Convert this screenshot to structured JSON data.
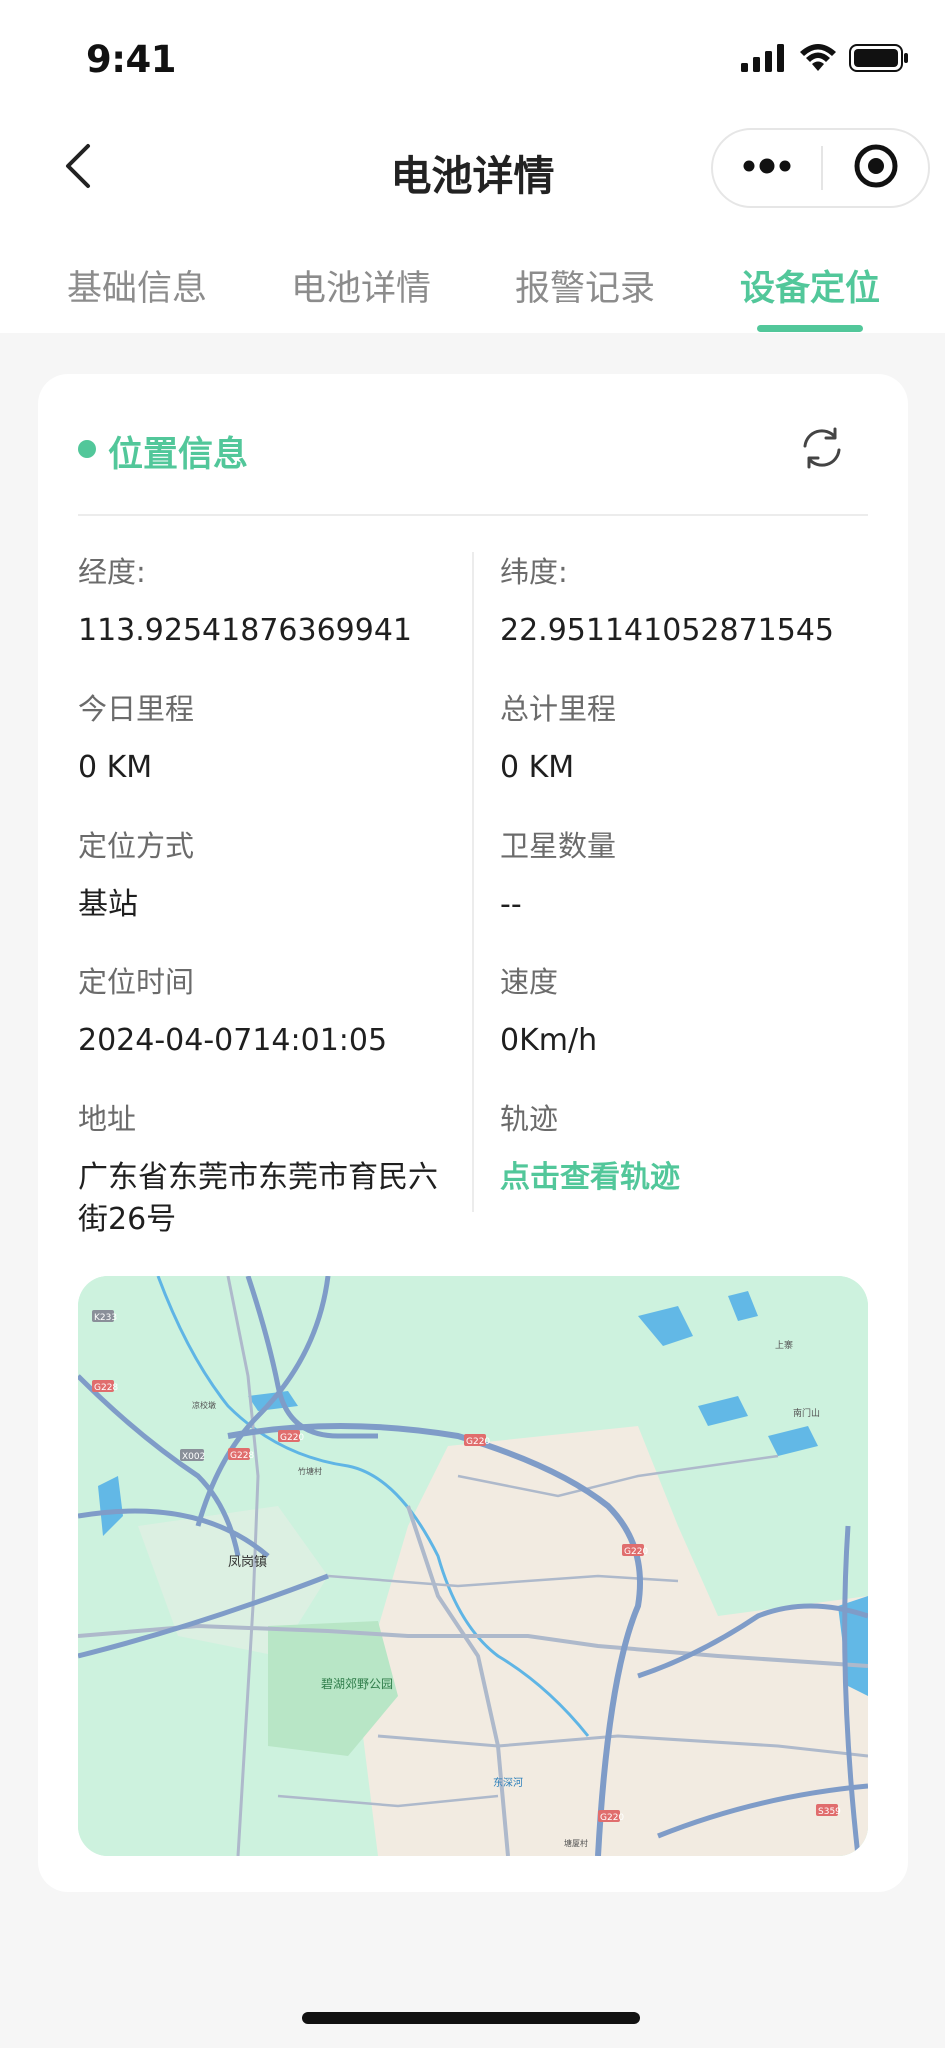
{
  "status_bar": {
    "time": "9:41"
  },
  "nav": {
    "title": "电池详情"
  },
  "tabs": [
    {
      "label": "基础信息",
      "active": false
    },
    {
      "label": "电池详情",
      "active": false
    },
    {
      "label": "报警记录",
      "active": false
    },
    {
      "label": "设备定位",
      "active": true
    }
  ],
  "card": {
    "title": "位置信息",
    "fields": {
      "longitude": {
        "label": "经度:",
        "value": "113.92541876369941"
      },
      "latitude": {
        "label": "纬度:",
        "value": "22.951141052871545"
      },
      "today_mileage": {
        "label": "今日里程",
        "value": "0 KM"
      },
      "total_mileage": {
        "label": "总计里程",
        "value": "0 KM"
      },
      "locate_method": {
        "label": "定位方式",
        "value": "基站"
      },
      "satellites": {
        "label": "卫星数量",
        "value": "--"
      },
      "locate_time": {
        "label": "定位时间",
        "value": "2024-04-0714:01:05"
      },
      "speed": {
        "label": "速度",
        "value": "0Km/h"
      },
      "address": {
        "label": "地址",
        "value": "广东省东莞市东莞市育民六街26号"
      },
      "track": {
        "label": "轨迹",
        "value": "点击查看轨迹"
      }
    }
  },
  "map": {
    "labels": {
      "fenggang": "凤岗镇",
      "bihu_park": "碧湖郊野公园",
      "shangzhai": "上寨",
      "nanmenshan": "南门山",
      "dongshenhe": "东深河",
      "zhutangcun": "竹塘村",
      "yandun": "凉校墩",
      "tangshancun": "塘厦村"
    },
    "road_badges": [
      "K233",
      "G228",
      "X002",
      "G228",
      "G220",
      "G220",
      "G220",
      "G220",
      "S359"
    ]
  },
  "colors": {
    "accent": "#52c79a",
    "map_green": "#cdf2de",
    "map_land": "#f2ebe1",
    "map_road": "#7f9cc8",
    "map_water": "#62b8e6"
  }
}
